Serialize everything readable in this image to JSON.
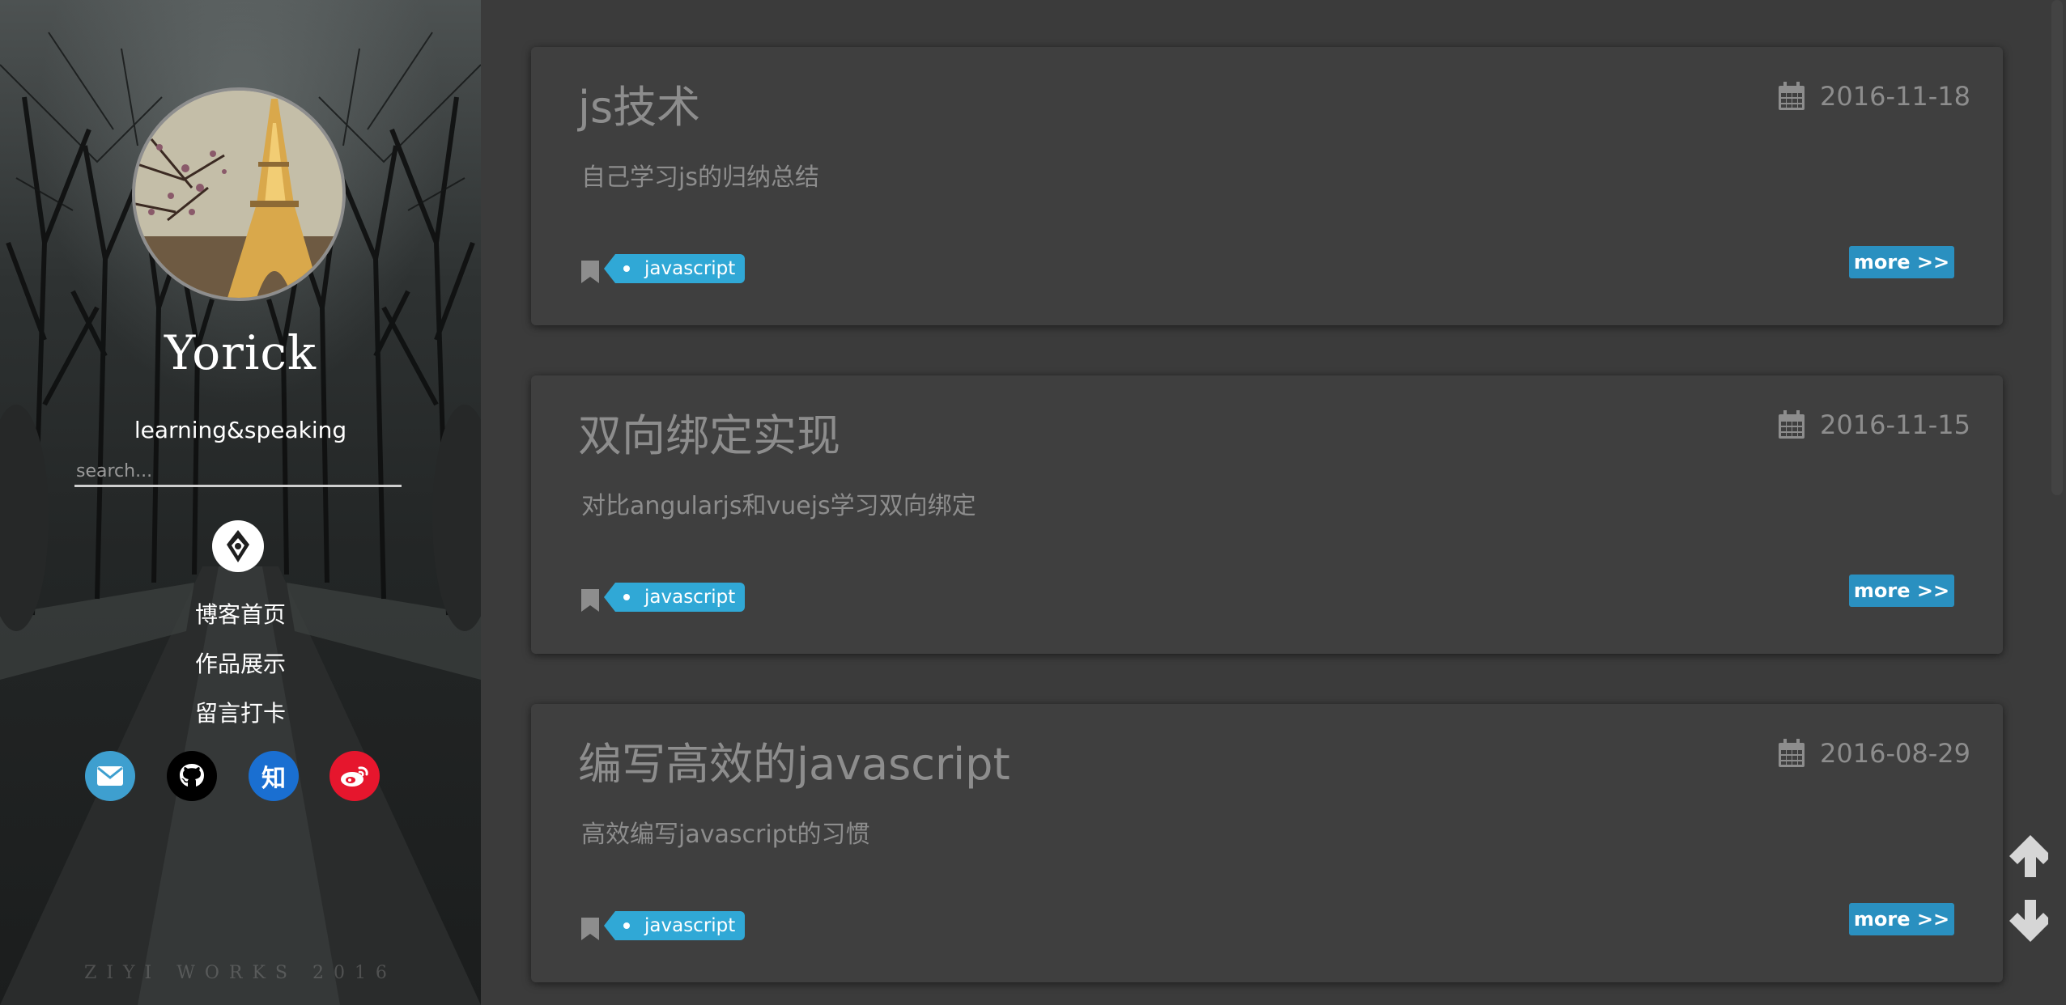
{
  "sidebar": {
    "site_name": "Yorick",
    "tagline": "learning&speaking",
    "search_placeholder": "search...",
    "nav": [
      {
        "label": "博客首页"
      },
      {
        "label": "作品展示"
      },
      {
        "label": "留言打卡"
      }
    ],
    "social": [
      {
        "name": "email",
        "icon": "mail-icon",
        "color": "#3e9fcf"
      },
      {
        "name": "github",
        "icon": "github-icon",
        "color": "#000000"
      },
      {
        "name": "zhihu",
        "icon": "zhihu-icon",
        "label": "知",
        "color": "#1a6fd1"
      },
      {
        "name": "weibo",
        "icon": "weibo-icon",
        "color": "#e6162d"
      }
    ],
    "watermark": "ZIYI WORKS 2016"
  },
  "posts": [
    {
      "title": "js技术",
      "date": "2016-11-18",
      "description": "自己学习js的归纳总结",
      "tag": "javascript",
      "more_label": "more >>"
    },
    {
      "title": "双向绑定实现",
      "date": "2016-11-15",
      "description": "对比angularjs和vuejs学习双向绑定",
      "tag": "javascript",
      "more_label": "more >>"
    },
    {
      "title": "编写高效的javascript",
      "date": "2016-08-29",
      "description": "高效编写javascript的习惯",
      "tag": "javascript",
      "more_label": "more >>"
    }
  ],
  "colors": {
    "accent": "#30a8d6",
    "button": "#2a90c0",
    "card_bg": "#3f3f3f",
    "page_bg": "#3b3b3b",
    "muted_text": "#8d8d8d"
  }
}
